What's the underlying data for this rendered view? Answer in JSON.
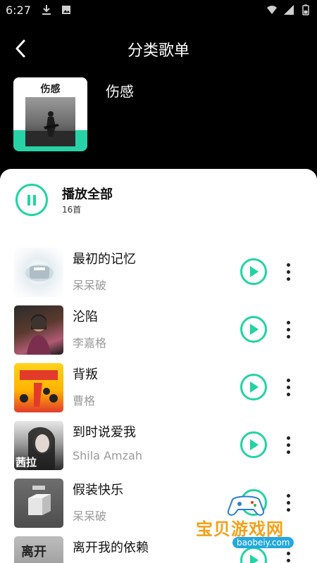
{
  "status_bar": {
    "time": "6:27",
    "left_icons": [
      "download-icon",
      "image-icon"
    ],
    "right_icons": [
      "wifi-icon",
      "signal-icon",
      "battery-icon"
    ]
  },
  "header": {
    "title": "分类歌单",
    "back_icon": "chevron-left-icon"
  },
  "playlist": {
    "cover_label": "伤感",
    "name": "伤感",
    "accent_color": "#22d3a4"
  },
  "play_all": {
    "label": "播放全部",
    "count": "16首"
  },
  "songs": [
    {
      "title": "最初的记忆",
      "artist": "呆呆破"
    },
    {
      "title": "沦陷",
      "artist": "李嘉格"
    },
    {
      "title": "背叛",
      "artist": "曹格"
    },
    {
      "title": "到时说爱我",
      "artist": "Shila Amzah"
    },
    {
      "title": "假装快乐",
      "artist": "呆呆破"
    },
    {
      "title": "离开我的依赖",
      "artist": ""
    }
  ],
  "thumb_texts": {
    "song4": "茜拉",
    "song6": "离开"
  },
  "watermark": {
    "text": "宝贝游戏网",
    "url": "baobeiy.com"
  }
}
